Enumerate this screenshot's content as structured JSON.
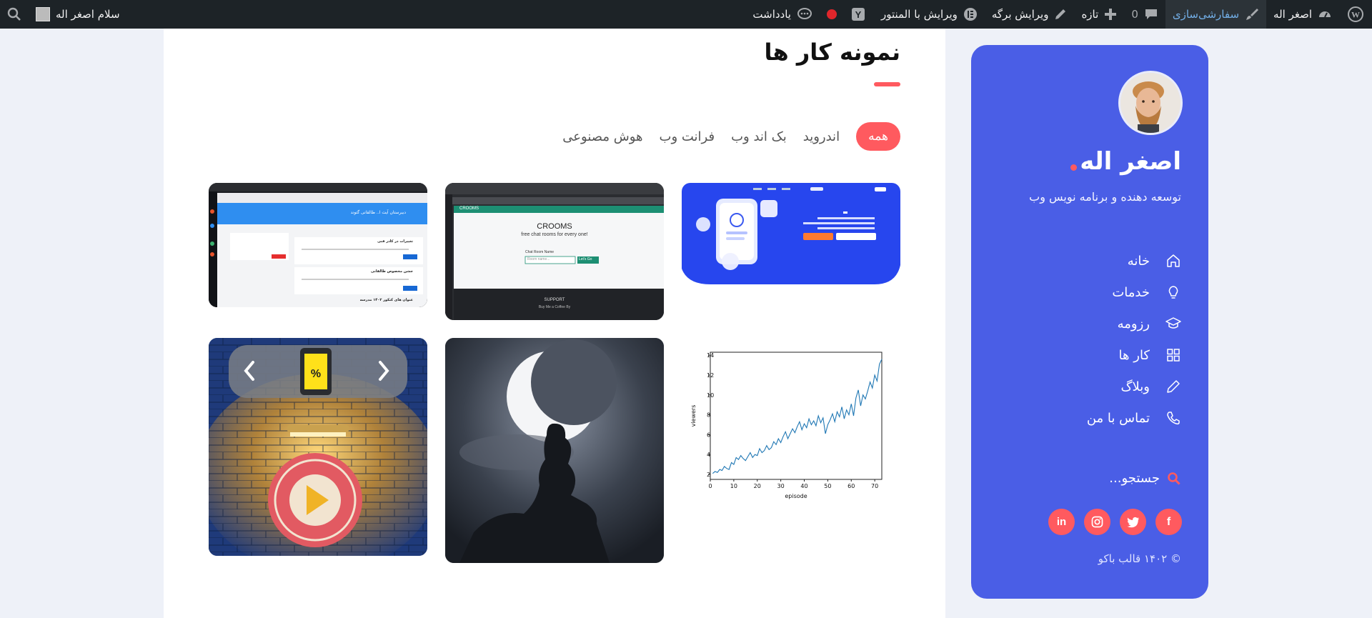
{
  "adminbar": {
    "site_name": "اصغر اله",
    "customize": "سفارشی‌سازی",
    "comments_count": "0",
    "new": "تازه",
    "edit_page": "ویرایش برگه",
    "edit_elementor": "ویرایش با المنتور",
    "notes": "یادداشت",
    "howdy": "سلام اصغر اله"
  },
  "sidebar": {
    "name": "اصغر اله",
    "subtitle": "توسعه دهنده و برنامه نویس وب",
    "nav": [
      {
        "label": "خانه",
        "icon": "home-icon"
      },
      {
        "label": "خدمات",
        "icon": "lightbulb-icon"
      },
      {
        "label": "رزومه",
        "icon": "graduation-cap-icon"
      },
      {
        "label": "کار ها",
        "icon": "grid-icon"
      },
      {
        "label": "وبلاگ",
        "icon": "pencil-icon"
      },
      {
        "label": "تماس با من",
        "icon": "phone-icon"
      }
    ],
    "search_placeholder": "جستجو...",
    "social": [
      "facebook-icon",
      "twitter-icon",
      "instagram-icon",
      "linkedin-icon"
    ],
    "copyright": "© ۱۴۰۲ قالب باکو"
  },
  "main": {
    "title": "نمونه کار ها",
    "filters": [
      "همه",
      "اندروید",
      "بک اند وب",
      "فرانت وب",
      "هوش مصنوعی"
    ],
    "active_filter": "همه"
  },
  "cards": {
    "crooms": {
      "brand": "CROOMS",
      "tagline": "free chat rooms for every one!",
      "room_label": "Chat Room Name",
      "placeholder": "Room name...",
      "button": "Let's Go",
      "support": "SUPPORT",
      "coffee": "Buy Me a Coffee By"
    },
    "school": {
      "header": "دبیرستان آیت ا.. طالقانی گتوند",
      "news1": "تغییرات در کادر فنی",
      "news2": "جشن مخصوص طالقانی",
      "news3": "عنوان های کنکور ۱۴۰۲ مدرسه"
    },
    "plot": {
      "xlabel": "episode",
      "ylabel": "viewers"
    }
  },
  "chart_data": {
    "type": "line",
    "xlabel": "episode",
    "ylabel": "viewers",
    "xlim": [
      0,
      73
    ],
    "ylim": [
      1.5,
      14.3
    ],
    "x_ticks": [
      0,
      10,
      20,
      30,
      40,
      50,
      60,
      70
    ],
    "y_ticks": [
      2,
      4,
      6,
      8,
      10,
      12,
      14
    ],
    "x": [
      1,
      2,
      3,
      4,
      5,
      6,
      7,
      8,
      9,
      10,
      11,
      12,
      13,
      14,
      15,
      16,
      17,
      18,
      19,
      20,
      21,
      22,
      23,
      24,
      25,
      26,
      27,
      28,
      29,
      30,
      31,
      32,
      33,
      34,
      35,
      36,
      37,
      38,
      39,
      40,
      41,
      42,
      43,
      44,
      45,
      46,
      47,
      48,
      49,
      50,
      51,
      52,
      53,
      54,
      55,
      56,
      57,
      58,
      59,
      60,
      61,
      62,
      63,
      64,
      65,
      66,
      67,
      68,
      69,
      70,
      71,
      72,
      73
    ],
    "values": [
      2.1,
      2.3,
      2.2,
      2.5,
      2.4,
      2.8,
      2.6,
      2.5,
      3.2,
      3.0,
      3.7,
      3.5,
      3.9,
      3.6,
      3.4,
      3.8,
      4.2,
      3.7,
      4.0,
      3.9,
      4.6,
      4.2,
      4.4,
      4.9,
      4.5,
      4.7,
      5.3,
      5.0,
      5.6,
      5.2,
      5.8,
      6.3,
      5.6,
      6.1,
      6.6,
      6.2,
      6.8,
      7.3,
      6.5,
      7.1,
      6.7,
      7.6,
      7.0,
      7.4,
      6.9,
      7.9,
      7.2,
      7.7,
      6.1,
      7.0,
      7.5,
      8.1,
      7.3,
      8.3,
      7.8,
      8.8,
      7.6,
      8.5,
      8.0,
      9.1,
      7.9,
      9.7,
      10.5,
      8.9,
      10.0,
      9.6,
      10.4,
      11.3,
      10.7,
      12.0,
      11.4,
      13.1,
      13.6
    ]
  },
  "colors": {
    "accent": "#ff5a5f",
    "sidebar": "#4a5ee6",
    "adminbar": "#1d2327",
    "plot_line": "#1f77b4"
  }
}
